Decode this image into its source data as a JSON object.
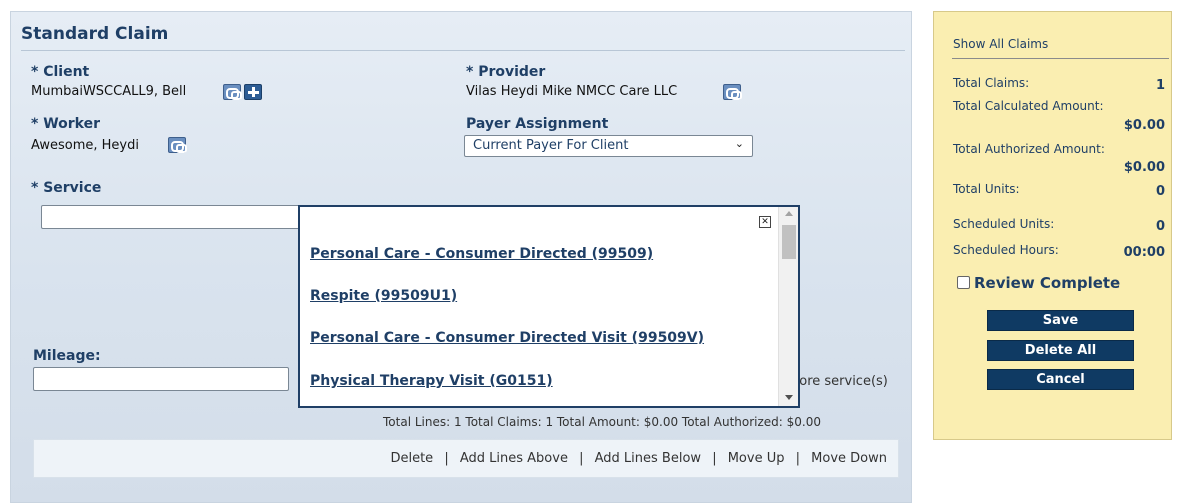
{
  "claim": {
    "title": "Standard Claim",
    "client_label": "* Client",
    "client_value": "MumbaiWSCCALL9, Bell",
    "provider_label": "* Provider",
    "provider_value": "Vilas Heydi Mike NMCC Care LLC",
    "worker_label": "* Worker",
    "worker_value": "Awesome, Heydi",
    "payer_label": "Payer Assignment",
    "payer_selected": "Current Payer For Client",
    "service_label": "* Service",
    "service_value": "",
    "mileage_label": "Mileage:",
    "mileage_value": "",
    "more_services_text": "nore service(s)",
    "totals_line": "Total Lines: 1 Total Claims: 1 Total Amount: $0.00 Total Authorized: $0.00"
  },
  "actions": {
    "delete": "Delete",
    "add_above": "Add Lines Above",
    "add_below": "Add Lines Below",
    "move_up": "Move Up",
    "move_down": "Move Down",
    "separator": "|"
  },
  "popup": {
    "services": [
      "Personal Care - Consumer Directed (99509)",
      "Respite (99509U1)",
      "Personal Care - Consumer Directed Visit (99509V)",
      "Physical Therapy Visit (G0151)"
    ]
  },
  "summary": {
    "show_all": "Show All Claims",
    "total_claims_label": "Total Claims:",
    "total_claims_value": "1",
    "total_calculated_label": "Total Calculated Amount:",
    "total_calculated_value": "$0.00",
    "total_authorized_label": "Total Authorized Amount:",
    "total_authorized_value": "$0.00",
    "total_units_label": "Total Units:",
    "total_units_value": "0",
    "scheduled_units_label": "Scheduled Units:",
    "scheduled_units_value": "0",
    "scheduled_hours_label": "Scheduled Hours:",
    "scheduled_hours_value": "00:00",
    "review_label": "Review Complete",
    "save_label": "Save",
    "delete_all_label": "Delete All",
    "cancel_label": "Cancel"
  },
  "icons": {
    "lookup": "lookup-icon",
    "add": "add-icon",
    "close": "close-icon",
    "chevron": "chevron-down-icon"
  },
  "colors": {
    "brand_navy": "#1f3f66",
    "button_navy": "#0f3a63",
    "summary_bg": "#faeeb1",
    "panel_bg": "#dde6f0"
  }
}
